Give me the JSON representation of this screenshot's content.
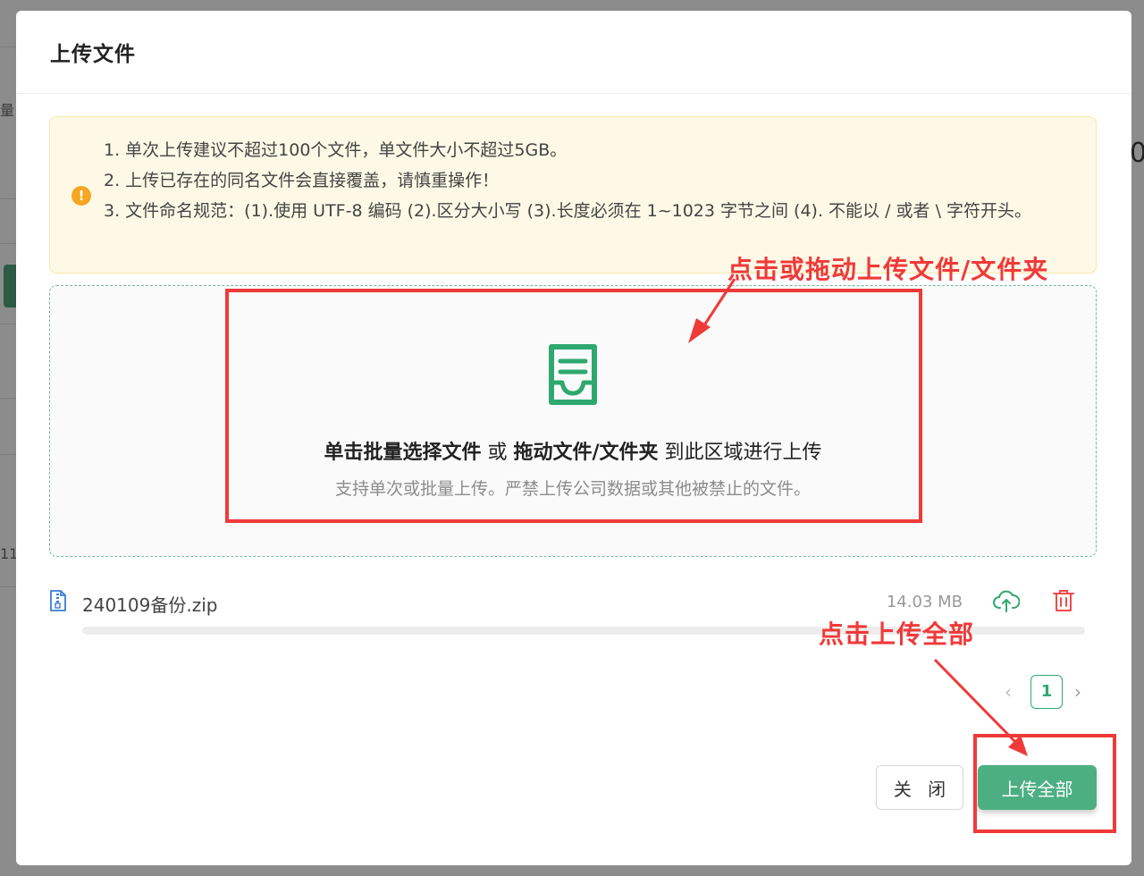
{
  "background": {
    "fragment_1": "量",
    "fragment_2": "0",
    "fragment_3": "11"
  },
  "modal": {
    "title": "上传文件"
  },
  "notice": {
    "icon": "warning-icon",
    "lines": [
      "1. 单次上传建议不超过100个文件，单文件大小不超过5GB。",
      "2. 上传已存在的同名文件会直接覆盖，请慎重操作！",
      "3. 文件命名规范：(1).使用 UTF-8 编码 (2).区分大小写 (3).长度必须在 1~1023 字节之间 (4). 不能以 / 或者 \\ 字符开头。"
    ]
  },
  "dropzone": {
    "icon": "document-tray-icon",
    "text_bold_1": "单击批量选择文件",
    "text_mid": " 或 ",
    "text_bold_2": "拖动文件/文件夹",
    "text_end": " 到此区域进行上传",
    "hint": "支持单次或批量上传。严禁上传公司数据或其他被禁止的文件。"
  },
  "file": {
    "name": "240109备份.zip",
    "size": "14.03 MB",
    "progress": 0
  },
  "pagination": {
    "current": "1"
  },
  "buttons": {
    "close": "关 闭",
    "upload_all": "上传全部"
  },
  "annotations": {
    "dropzone_label": "点击或拖动上传文件/文件夹",
    "upload_label": "点击上传全部"
  },
  "colors": {
    "accent": "#4caf82",
    "annotation": "#f03a3a",
    "notice_bg": "#fef9e6",
    "warning": "#f5a623"
  }
}
